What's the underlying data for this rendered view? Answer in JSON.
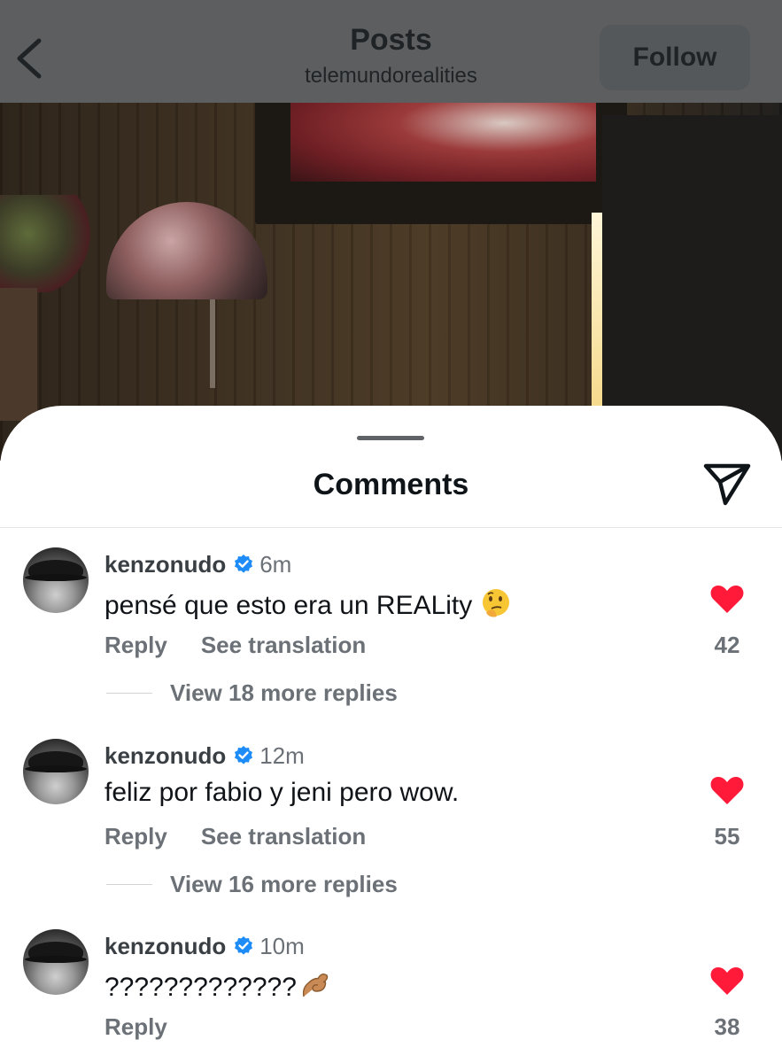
{
  "header": {
    "title": "Posts",
    "subtitle": "telemundorealities",
    "follow_label": "Follow",
    "back_icon": "chevron-left-icon"
  },
  "sheet": {
    "title": "Comments",
    "share_icon": "send-icon"
  },
  "comments": [
    {
      "username": "kenzonudo",
      "verified": true,
      "time": "6m",
      "text": "pensé que esto era un REALity",
      "emoji": "thinking-face",
      "reply_label": "Reply",
      "translate_label": "See translation",
      "likes": "42",
      "view_replies": "View 18 more replies"
    },
    {
      "username": "kenzonudo",
      "verified": true,
      "time": "12m",
      "text": "feliz por fabio y jeni pero wow.",
      "reply_label": "Reply",
      "translate_label": "See translation",
      "likes": "55",
      "view_replies": "View 16 more replies"
    },
    {
      "username": "kenzonudo",
      "verified": true,
      "time": "10m",
      "text": "?????????????",
      "emoji": "pinched-fingers",
      "reply_label": "Reply",
      "likes": "38"
    }
  ],
  "colors": {
    "heart": "#ff1a3a",
    "verified": "#1d8cf8",
    "secondary_text": "#6b7177"
  }
}
